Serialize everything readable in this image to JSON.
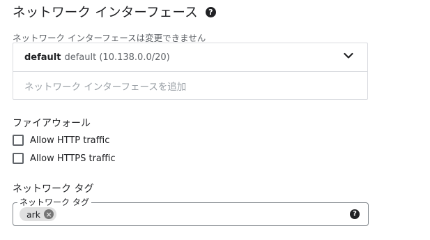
{
  "network_interfaces": {
    "title": "ネットワーク インターフェース",
    "help_icon": "help-circle-icon",
    "notice": "ネットワーク インターフェースは変更できません",
    "interface": {
      "name": "default",
      "detail": "default (10.138.0.0/20)",
      "expand_icon": "chevron-down-icon"
    },
    "add_label": "ネットワーク インターフェースを追加"
  },
  "firewall": {
    "heading": "ファイアウォール",
    "options": [
      {
        "label": "Allow HTTP traffic",
        "checked": false
      },
      {
        "label": "Allow HTTPS traffic",
        "checked": false
      }
    ]
  },
  "network_tags": {
    "heading": "ネットワーク タグ",
    "field_label": "ネットワーク タグ",
    "tags": [
      {
        "label": "ark",
        "remove_icon": "cancel-circle-icon"
      }
    ],
    "help_icon": "help-circle-icon"
  },
  "colors": {
    "text_primary": "#202124",
    "text_secondary": "#5f6368",
    "text_placeholder": "#9aa0a6",
    "border": "#dadce0",
    "chip_background": "#e0e0e0"
  }
}
